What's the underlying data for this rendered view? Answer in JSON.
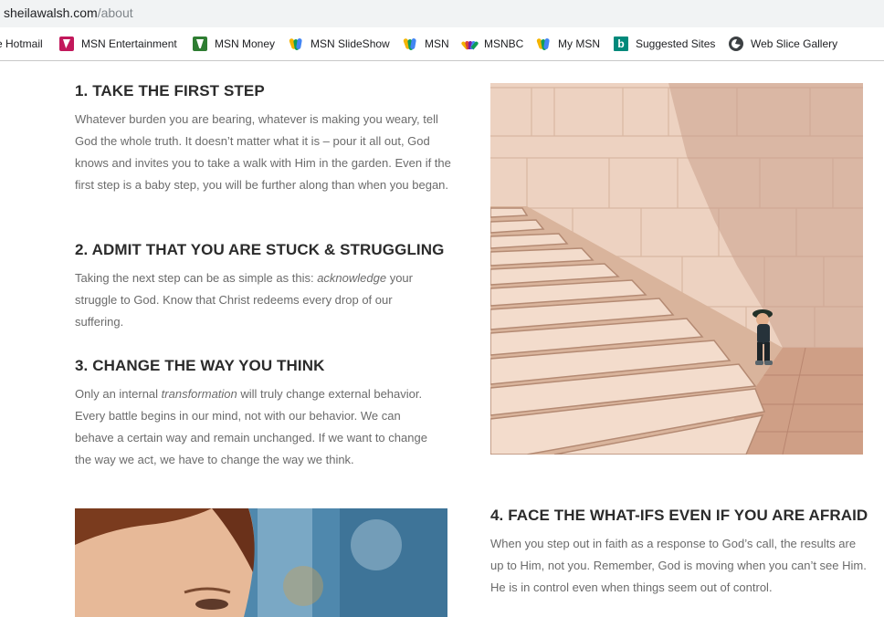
{
  "address_bar": {
    "domain": "sheilawalsh.com",
    "path": "/about"
  },
  "favorites": [
    {
      "label": "e Hotmail",
      "icon": "hotmail-icon"
    },
    {
      "label": "MSN Entertainment",
      "icon": "msn-entertainment-icon"
    },
    {
      "label": "MSN Money",
      "icon": "msn-money-icon"
    },
    {
      "label": "MSN SlideShow",
      "icon": "msn-butterfly-icon"
    },
    {
      "label": "MSN",
      "icon": "msn-butterfly-icon"
    },
    {
      "label": "MSNBC",
      "icon": "nbc-peacock-icon"
    },
    {
      "label": "My MSN",
      "icon": "msn-butterfly-icon"
    },
    {
      "label": "Suggested Sites",
      "icon": "bing-icon"
    },
    {
      "label": "Web Slice Gallery",
      "icon": "globe-icon"
    }
  ],
  "sections": [
    {
      "title": "1. TAKE THE FIRST STEP",
      "body": "Whatever burden you are bearing, whatever is making you weary, tell God the whole truth. It doesn’t matter what it is – pour it all out, God knows and invites you to take a walk with Him in the garden. Even if the first step is a baby step, you will be further along than when you began."
    },
    {
      "title": "2. ADMIT THAT YOU ARE STUCK & STRUGGLING",
      "body_before": "Taking the next step can be as simple as this: ",
      "body_em": "acknowledge",
      "body_after": " your struggle to God. Know that Christ redeems every drop of our suffering."
    },
    {
      "title": "3. CHANGE THE WAY YOU THINK",
      "body_before": "Only an internal ",
      "body_em": "transformation",
      "body_after": " will truly change external behavior. Every battle begins in our mind, not with our behavior. We can behave a certain way and remain unchanged. If we want to change the way we act, we have to change the way we think."
    },
    {
      "title": "4. FACE THE WHAT-IFS EVEN IF YOU ARE AFRAID",
      "body": "When you step out in faith as a response to God’s call, the results are up to Him, not you. Remember, God is moving when you can’t see Him. He is in control even when things seem out of control."
    }
  ],
  "colors": {
    "heading": "#2b2b2b",
    "body_text": "#6b6b6b",
    "stone_light": "#efd2c0",
    "stone_shadow": "#c9a08a",
    "photo2_bg": "#5a8fb0"
  }
}
